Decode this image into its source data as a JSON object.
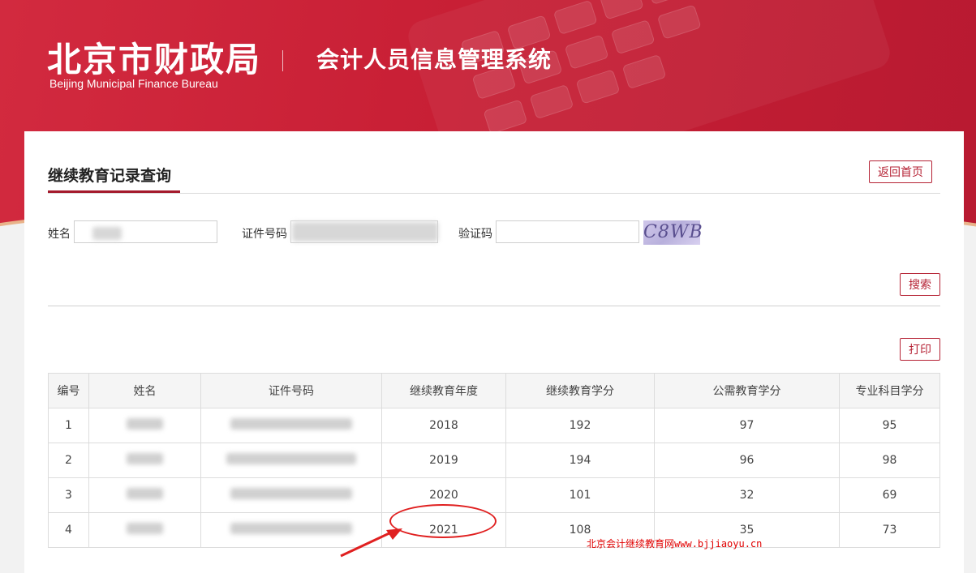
{
  "header": {
    "brand_cn": "北京市财政局",
    "brand_en": "Beijing Municipal Finance Bureau",
    "system_title": "会计人员信息管理系统",
    "accent_color": "#c81f35"
  },
  "page": {
    "section_title": "继续教育记录查询",
    "back_home_label": "返回首页"
  },
  "search": {
    "name_label": "姓名",
    "name_value": "",
    "id_label": "证件号码",
    "id_value": "",
    "captcha_label": "验证码",
    "captcha_value": "",
    "captcha_image_text": "C8WB",
    "search_button": "搜索",
    "print_button": "打印"
  },
  "table": {
    "columns": [
      "编号",
      "姓名",
      "证件号码",
      "继续教育年度",
      "继续教育学分",
      "公需教育学分",
      "专业科目学分"
    ],
    "rows": [
      {
        "no": "1",
        "year": "2018",
        "ce_credits": "192",
        "public_credits": "97",
        "prof_credits": "95"
      },
      {
        "no": "2",
        "year": "2019",
        "ce_credits": "194",
        "public_credits": "96",
        "prof_credits": "98"
      },
      {
        "no": "3",
        "year": "2020",
        "ce_credits": "101",
        "public_credits": "32",
        "prof_credits": "69"
      },
      {
        "no": "4",
        "year": "2021",
        "ce_credits": "108",
        "public_credits": "35",
        "prof_credits": "73"
      }
    ]
  },
  "watermark": {
    "text": "北京会计继续教育网",
    "url": "www.bjjiaoyu.cn"
  }
}
